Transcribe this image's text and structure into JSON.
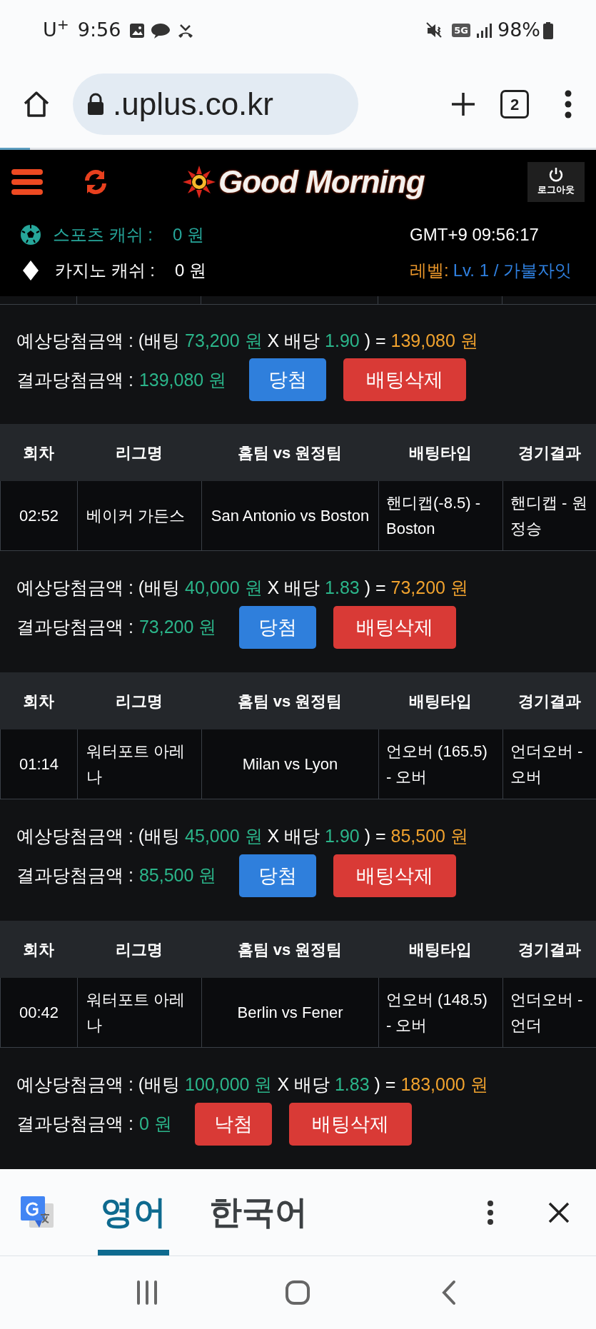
{
  "status_bar": {
    "carrier": "U$^{+}$",
    "time": "9:56",
    "network": "5G",
    "battery": "98%"
  },
  "browser": {
    "url": ".uplus.co.kr",
    "tab_count": "2"
  },
  "header": {
    "logo": "Good Morning",
    "logout": "로그아웃",
    "sports_cash": {
      "label": "스포츠 캐쉬 :",
      "value": "0 원"
    },
    "casino_cash": {
      "label": "카지노 캐쉬 :",
      "value": "0 원"
    },
    "clock": "GMT+9 09:56:17",
    "level_label": "레벨:",
    "level_value": "Lv. 1 / 가불자잇"
  },
  "first_summary": {
    "expected": {
      "label": "예상당첨금액 : (배팅",
      "stake": "73,200 원",
      "times": "X 배당",
      "odds": "1.90",
      "equals": ") =",
      "payout": "139,080 원"
    },
    "result": {
      "label": "결과당첨금액 :",
      "amount": "139,080 원"
    },
    "result_button": {
      "label": "당첨",
      "kind": "win"
    },
    "delete_button": "배팅삭제"
  },
  "bets": [
    {
      "columns": [
        "회차",
        "리그명",
        "홈팀 vs 원정팀",
        "배팅타입",
        "경기결과"
      ],
      "row": {
        "round": "02:52",
        "league": "베이커 가든스",
        "match": "San Antonio vs Boston",
        "bet_type": "핸디캡(-8.5) - Boston",
        "result": "핸디캡 - 원정승"
      },
      "expected": {
        "label": "예상당첨금액 : (배팅",
        "stake": "40,000 원",
        "times": "X 배당",
        "odds": "1.83",
        "equals": ") =",
        "payout": "73,200 원"
      },
      "result": {
        "label": "결과당첨금액 :",
        "amount": "73,200 원"
      },
      "result_button": {
        "label": "당첨",
        "kind": "win"
      },
      "delete_button": "배팅삭제"
    },
    {
      "columns": [
        "회차",
        "리그명",
        "홈팀 vs 원정팀",
        "배팅타입",
        "경기결과"
      ],
      "row": {
        "round": "01:14",
        "league": "워터포트 아레나",
        "match": "Milan vs Lyon",
        "bet_type": "언오버 (165.5) - 오버",
        "result": "언더오버 - 오버"
      },
      "expected": {
        "label": "예상당첨금액 : (배팅",
        "stake": "45,000 원",
        "times": "X 배당",
        "odds": "1.90",
        "equals": ") =",
        "payout": "85,500 원"
      },
      "result": {
        "label": "결과당첨금액 :",
        "amount": "85,500 원"
      },
      "result_button": {
        "label": "당첨",
        "kind": "win"
      },
      "delete_button": "배팅삭제"
    },
    {
      "columns": [
        "회차",
        "리그명",
        "홈팀 vs 원정팀",
        "배팅타입",
        "경기결과"
      ],
      "row": {
        "round": "00:42",
        "league": "워터포트 아레나",
        "match": "Berlin vs Fener",
        "bet_type": "언오버 (148.5) - 오버",
        "result": "언더오버 - 언더"
      },
      "expected": {
        "label": "예상당첨금액 : (배팅",
        "stake": "100,000 원",
        "times": "X 배당",
        "odds": "1.83",
        "equals": ") =",
        "payout": "183,000 원"
      },
      "result": {
        "label": "결과당첨금액 :",
        "amount": "0 원"
      },
      "result_button": {
        "label": "낙첨",
        "kind": "lose"
      },
      "delete_button": "배팅삭제"
    }
  ],
  "translate_bar": {
    "tabs": [
      {
        "label": "영어",
        "selected": true
      },
      {
        "label": "한국어",
        "selected": false
      }
    ]
  }
}
